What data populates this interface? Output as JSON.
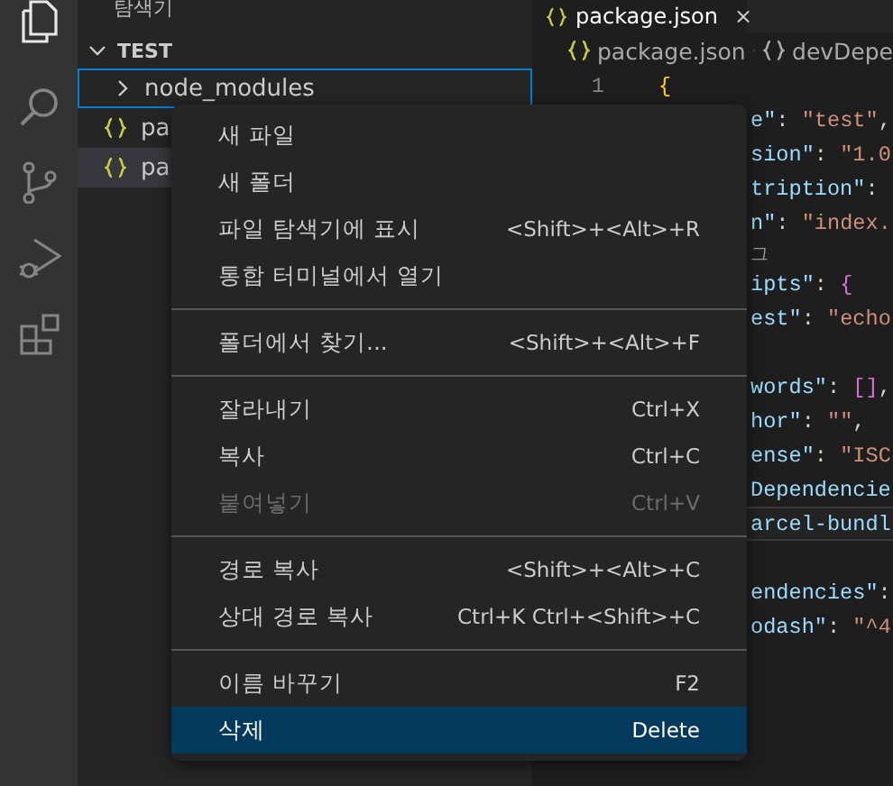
{
  "activity_bar": [
    {
      "kind": "files",
      "selected": true
    },
    {
      "kind": "search",
      "selected": false
    },
    {
      "kind": "source-control",
      "selected": false
    },
    {
      "kind": "debug",
      "selected": false
    },
    {
      "kind": "extensions",
      "selected": false
    }
  ],
  "sidebar": {
    "title": "탐색기",
    "section": "TEST",
    "items": [
      {
        "kind": "folder",
        "label": "node_modules",
        "focused": true,
        "selected": false
      },
      {
        "kind": "json",
        "label": "pa",
        "focused": false,
        "selected": false
      },
      {
        "kind": "json",
        "label": "pa",
        "focused": false,
        "selected": true
      }
    ]
  },
  "editor": {
    "tab": {
      "label": "package.json",
      "close": "×"
    },
    "breadcrumb": [
      "package.json",
      "devDepe"
    ],
    "lines": [
      {
        "kind": "code",
        "number": "1",
        "current": false,
        "tokens": [
          {
            "kind": "bracket1",
            "text": "{"
          }
        ]
      },
      {
        "kind": "code",
        "current": false,
        "tokens": [
          {
            "kind": "key",
            "text": "e\""
          },
          {
            "kind": "punct",
            "text": ": "
          },
          {
            "kind": "string",
            "text": "\"test\""
          },
          {
            "kind": "punct",
            "text": ","
          }
        ]
      },
      {
        "kind": "code",
        "current": false,
        "tokens": [
          {
            "kind": "key",
            "text": "sion\""
          },
          {
            "kind": "punct",
            "text": ": "
          },
          {
            "kind": "string",
            "text": "\"1.0"
          }
        ]
      },
      {
        "kind": "code",
        "current": false,
        "tokens": [
          {
            "kind": "key",
            "text": "tription\""
          },
          {
            "kind": "punct",
            "text": ":"
          }
        ]
      },
      {
        "kind": "code",
        "current": false,
        "tokens": [
          {
            "kind": "key",
            "text": "n\""
          },
          {
            "kind": "punct",
            "text": ": "
          },
          {
            "kind": "string",
            "text": "\"index."
          }
        ]
      },
      {
        "kind": "codelens",
        "text": "그"
      },
      {
        "kind": "code",
        "current": false,
        "tokens": [
          {
            "kind": "key",
            "text": "ipts\""
          },
          {
            "kind": "punct",
            "text": ": "
          },
          {
            "kind": "bracket2",
            "text": "{"
          }
        ]
      },
      {
        "kind": "code",
        "current": false,
        "tokens": [
          {
            "kind": "key",
            "text": "est\""
          },
          {
            "kind": "punct",
            "text": ": "
          },
          {
            "kind": "string",
            "text": "\"echo"
          }
        ]
      },
      {
        "kind": "code",
        "current": false
      },
      {
        "kind": "code",
        "current": false,
        "tokens": [
          {
            "kind": "key",
            "text": "words\""
          },
          {
            "kind": "punct",
            "text": ": "
          },
          {
            "kind": "bracket2",
            "text": "[]"
          },
          {
            "kind": "punct",
            "text": ","
          }
        ]
      },
      {
        "kind": "code",
        "current": false,
        "tokens": [
          {
            "kind": "key",
            "text": "hor\""
          },
          {
            "kind": "punct",
            "text": ": "
          },
          {
            "kind": "string",
            "text": "\"\""
          },
          {
            "kind": "punct",
            "text": ","
          }
        ]
      },
      {
        "kind": "code",
        "current": false,
        "tokens": [
          {
            "kind": "key",
            "text": "ense\""
          },
          {
            "kind": "punct",
            "text": ": "
          },
          {
            "kind": "string",
            "text": "\"ISC"
          }
        ]
      },
      {
        "kind": "code",
        "current": false,
        "tokens": [
          {
            "kind": "key",
            "text": "Dependencie"
          }
        ]
      },
      {
        "kind": "code",
        "current": true,
        "tokens": [
          {
            "kind": "key",
            "text": "arcel-bundl"
          }
        ]
      },
      {
        "kind": "code",
        "current": false
      },
      {
        "kind": "code",
        "current": false,
        "tokens": [
          {
            "kind": "key",
            "text": "endencies\""
          },
          {
            "kind": "punct",
            "text": ":"
          }
        ]
      },
      {
        "kind": "code",
        "current": false,
        "tokens": [
          {
            "kind": "key",
            "text": "odash\""
          },
          {
            "kind": "punct",
            "text": ": "
          },
          {
            "kind": "string",
            "text": "\"^4"
          }
        ]
      }
    ]
  },
  "context_menu": [
    {
      "kind": "item",
      "label": "새 파일",
      "disabled": false,
      "selected": false
    },
    {
      "kind": "item",
      "label": "새 폴더",
      "disabled": false,
      "selected": false
    },
    {
      "kind": "item",
      "label": "파일 탐색기에 표시",
      "shortcut": "<Shift>+<Alt>+R",
      "disabled": false,
      "selected": false
    },
    {
      "kind": "item",
      "label": "통합 터미널에서 열기",
      "disabled": false,
      "selected": false
    },
    {
      "kind": "separator"
    },
    {
      "kind": "item",
      "label": "폴더에서 찾기...",
      "shortcut": "<Shift>+<Alt>+F",
      "disabled": false,
      "selected": false
    },
    {
      "kind": "separator"
    },
    {
      "kind": "item",
      "label": "잘라내기",
      "shortcut": "Ctrl+X",
      "disabled": false,
      "selected": false
    },
    {
      "kind": "item",
      "label": "복사",
      "shortcut": "Ctrl+C",
      "disabled": false,
      "selected": false
    },
    {
      "kind": "item",
      "label": "붙여넣기",
      "shortcut": "Ctrl+V",
      "disabled": true,
      "selected": false
    },
    {
      "kind": "separator"
    },
    {
      "kind": "item",
      "label": "경로 복사",
      "shortcut": "<Shift>+<Alt>+C",
      "disabled": false,
      "selected": false
    },
    {
      "kind": "item",
      "label": "상대 경로 복사",
      "shortcut": "Ctrl+K Ctrl+<Shift>+C",
      "disabled": false,
      "selected": false
    },
    {
      "kind": "separator"
    },
    {
      "kind": "item",
      "label": "이름 바꾸기",
      "shortcut": "F2",
      "disabled": false,
      "selected": false
    },
    {
      "kind": "item",
      "label": "삭제",
      "shortcut": "Delete",
      "disabled": false,
      "selected": true
    }
  ]
}
